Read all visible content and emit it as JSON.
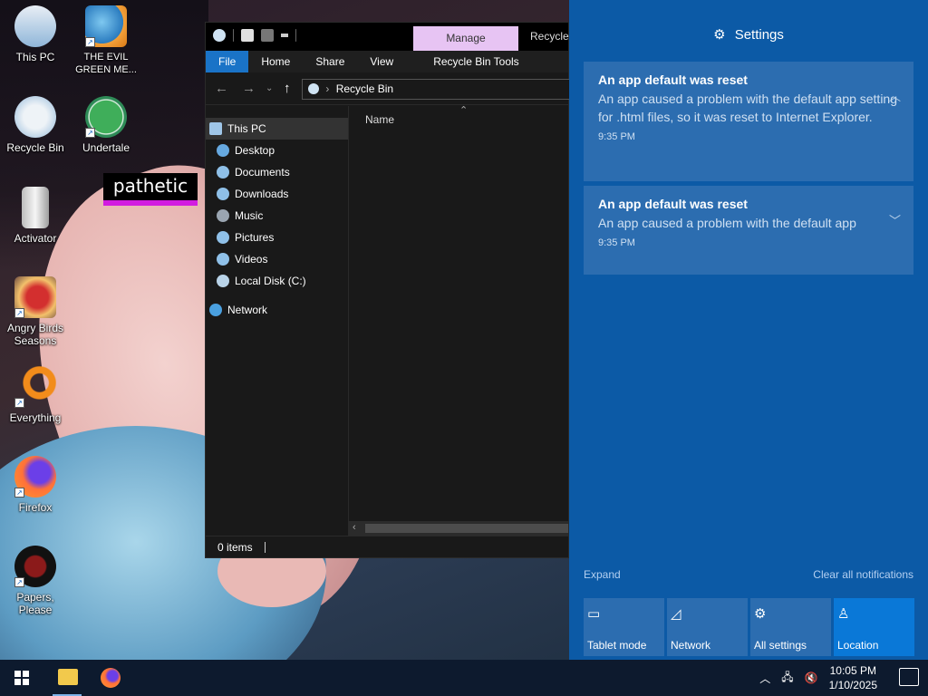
{
  "desktop": {
    "icons": [
      {
        "label": "This PC"
      },
      {
        "label": "THE EVIL GREEN ME..."
      },
      {
        "label": "Recycle Bin"
      },
      {
        "label": "Undertale"
      },
      {
        "label": "Activator"
      },
      {
        "label": "Angry Birds Seasons"
      },
      {
        "label": "Everything"
      },
      {
        "label": "Firefox"
      },
      {
        "label": "Papers, Please"
      }
    ],
    "overlay_text": "pathetic"
  },
  "explorer": {
    "contextual_tab": "Manage",
    "title_partial": "Recycle",
    "ribbon_tabs": [
      "File",
      "Home",
      "Share",
      "View",
      "Recycle Bin Tools"
    ],
    "address": "Recycle Bin",
    "nav_items": [
      "This PC",
      "Desktop",
      "Documents",
      "Downloads",
      "Music",
      "Pictures",
      "Videos",
      "Local Disk (C:)",
      "Network"
    ],
    "column_header": "Name",
    "status": "0 items"
  },
  "action_center": {
    "header": "Settings",
    "notifications": [
      {
        "title": "An app default was reset",
        "body": "An app caused a problem with the default app setting for .html files, so it was reset to Internet Explorer.",
        "time": "9:35 PM"
      },
      {
        "title": "An app default was reset",
        "body": "An app caused a problem with the default app",
        "time": "9:35 PM"
      }
    ],
    "expand_label": "Expand",
    "clear_label": "Clear all notifications",
    "quick_actions": [
      {
        "label": "Tablet mode",
        "icon": "tablet-mode-icon",
        "active": false
      },
      {
        "label": "Network",
        "icon": "network-icon",
        "active": false
      },
      {
        "label": "All settings",
        "icon": "gear-icon",
        "active": false
      },
      {
        "label": "Location",
        "icon": "location-icon",
        "active": true
      }
    ],
    "colors": {
      "panel": "#0c5aa6",
      "tile": "#2c6db0",
      "tile_active": "#0a78d7"
    }
  },
  "taskbar": {
    "time": "10:05 PM",
    "date": "1/10/2025"
  }
}
